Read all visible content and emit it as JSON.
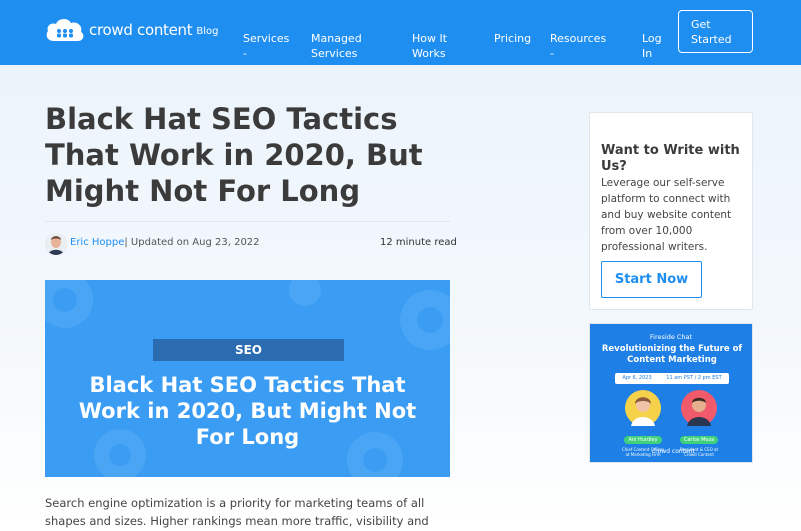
{
  "header": {
    "logo_text": "crowd content",
    "logo_sub": "Blog",
    "nav": [
      {
        "label": "Services",
        "sub": "-"
      },
      {
        "label": "Managed\nServices",
        "sub": ""
      },
      {
        "label": "How It\nWorks",
        "sub": ""
      },
      {
        "label": "Pricing",
        "sub": ""
      },
      {
        "label": "Resources",
        "sub": "-"
      },
      {
        "label": "Log\nIn",
        "sub": ""
      }
    ],
    "cta": "Get\nStarted"
  },
  "article": {
    "title": "Black Hat SEO Tactics That Work in 2020, But Might Not For Long",
    "author": "Eric Hoppe",
    "updated": "| Updated on Aug 23, 2022",
    "read_time": "12 minute read",
    "hero_tag": "SEO",
    "hero_title": "Black Hat SEO Tactics That Work in 2020, But Might Not For Long",
    "body": "Search engine optimization is a priority for marketing teams of all shapes and sizes. Higher rankings mean more traffic, visibility and conversions – so"
  },
  "sidebar": {
    "write_title": "Want to Write with Us?",
    "write_body": "Leverage our self-serve platform to connect with and buy website content from over 10,000 professional writers.",
    "start_button": "Start Now",
    "promo": {
      "eyebrow": "Fireside Chat",
      "title": "Revolutionizing the Future of Content Marketing",
      "date": "Apr 6, 2023",
      "time": "11 am PST / 2 pm EST",
      "speaker1_name": "Ani Hurdley",
      "speaker1_role": "Chief Content Officer at Marketing Firm",
      "speaker2_name": "Carlos Meza",
      "speaker2_role": "President & CEO at Crowd Content",
      "logo": "crowd content"
    }
  },
  "colors": {
    "header_bg": "#1f8ef1",
    "accent": "#1f8ef1",
    "hero_bg": "#3a9cf3",
    "tag_bg": "#2b6cb0",
    "speaker_badge": "#3fd17c"
  }
}
